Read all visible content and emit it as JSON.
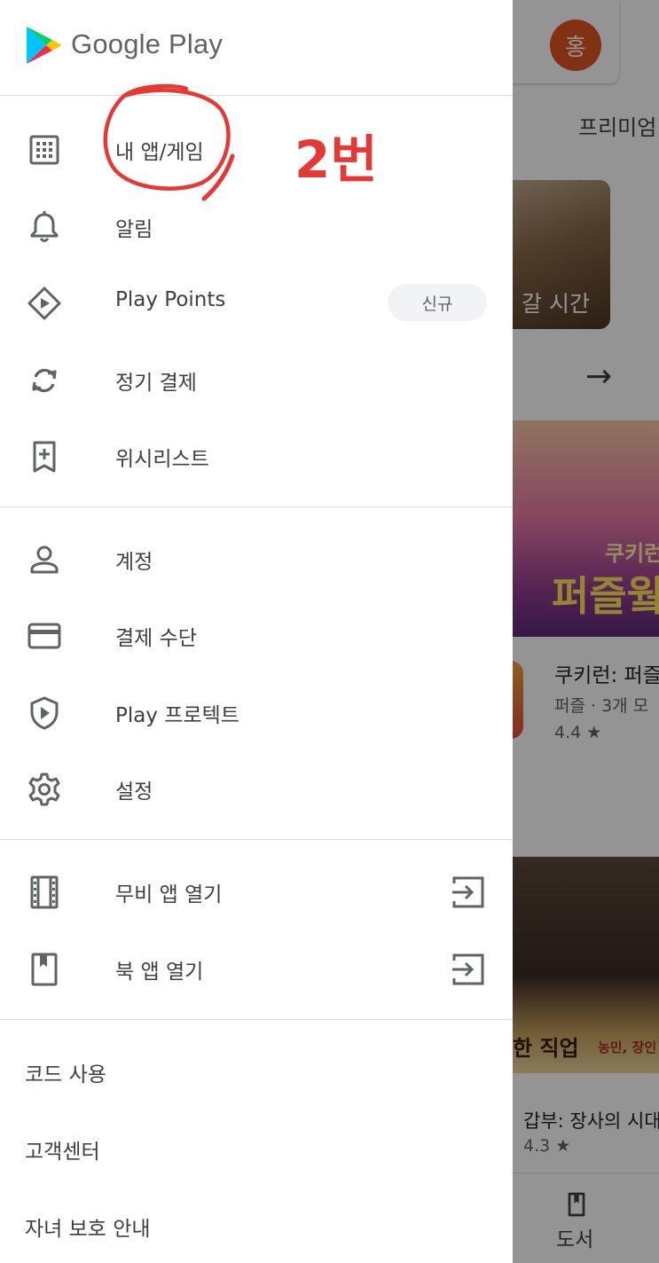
{
  "background": {
    "avatar_letter": "홍",
    "tab_label": "프리미엄",
    "tile_caption": "갈 시간",
    "banner1_line1": "쿠키런",
    "banner1_line2": "퍼즐웤",
    "app1": {
      "title": "쿠키런: 퍼즐",
      "subtitle": "퍼즐 · 3개 모",
      "rating": "4.4 ★"
    },
    "banner2_title": "한 직업",
    "banner2_sub": "농민, 장인",
    "app2": {
      "title": "갑부: 장사의 시대",
      "rating": "4.3 ★"
    },
    "bottom_nav_label": "도서"
  },
  "drawer": {
    "logo_text": "Google Play",
    "section1": [
      {
        "label": "내 앱/게임",
        "icon": "apps-grid-icon"
      },
      {
        "label": "알림",
        "icon": "bell-icon"
      },
      {
        "label": "Play Points",
        "icon": "play-points-icon",
        "badge": "신규"
      },
      {
        "label": "정기 결제",
        "icon": "subscription-refresh-icon"
      },
      {
        "label": "위시리스트",
        "icon": "wishlist-bookmark-icon"
      }
    ],
    "section2": [
      {
        "label": "계정",
        "icon": "account-icon"
      },
      {
        "label": "결제 수단",
        "icon": "credit-card-icon"
      },
      {
        "label": "Play 프로텍트",
        "icon": "shield-play-icon"
      },
      {
        "label": "설정",
        "icon": "gear-icon"
      }
    ],
    "section3": [
      {
        "label": "무비 앱 열기",
        "icon": "film-icon",
        "trailing": "open-external-icon"
      },
      {
        "label": "북 앱 열기",
        "icon": "book-icon",
        "trailing": "open-external-icon"
      }
    ],
    "section4": [
      {
        "label": "코드 사용"
      },
      {
        "label": "고객센터"
      },
      {
        "label": "자녀 보호 안내"
      }
    ]
  },
  "annotation": {
    "text": "2번",
    "color": "#e53935"
  }
}
